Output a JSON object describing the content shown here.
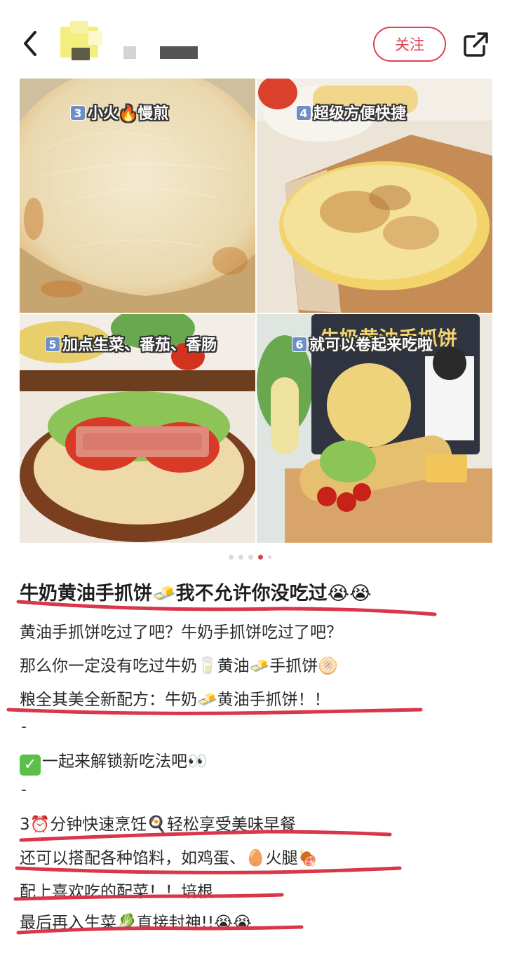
{
  "header": {
    "follow_label": "关注"
  },
  "gallery": {
    "tiles": [
      {
        "num": "3",
        "caption": "小火🔥慢煎"
      },
      {
        "num": "4",
        "caption": "超级方便快捷"
      },
      {
        "num": "5",
        "caption": "加点生菜、番茄、香肠"
      },
      {
        "num": "6",
        "caption": "就可以卷起来吃啦"
      }
    ],
    "package_text": "牛奶黄油手抓饼",
    "current_page": 4,
    "total_pages": 5
  },
  "post": {
    "title": "牛奶黄油手抓饼🧈我不允许你没吃过😭😭",
    "lines": [
      "黄油手抓饼吃过了吧？牛奶手抓饼吃过了吧？",
      "那么你一定没有吃过牛奶🥛黄油🧈手抓饼🫓",
      "粮全其美全新配方：牛奶🧈黄油手抓饼！！",
      "-",
      "一起来解锁新吃法吧👀",
      "-",
      "3⏰分钟快速烹饪🍳轻松享受美味早餐",
      "还可以搭配各种馅料，如鸡蛋、🥚火腿🍖",
      "配上喜欢吃的配菜！！培根...",
      "最后再入生菜🥬直接封神!!😭😭"
    ]
  },
  "colors": {
    "accent": "#e0404f",
    "underline": "#d9364a"
  }
}
